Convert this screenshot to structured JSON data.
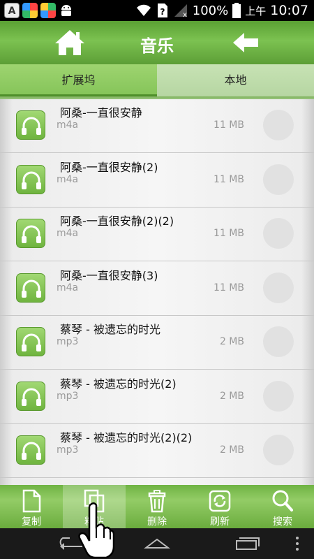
{
  "status_bar": {
    "icons": [
      "a-icon",
      "pinwheel-icon",
      "pinwheel-icon",
      "android-icon"
    ],
    "battery": "100%",
    "ampm": "上午",
    "time": "10:07"
  },
  "header": {
    "title": "音乐"
  },
  "tabs": [
    {
      "label": "扩展坞",
      "selected": true
    },
    {
      "label": "本地",
      "selected": false
    }
  ],
  "files": [
    {
      "name": "阿桑-一直很安静",
      "type": "m4a",
      "size": "11 MB"
    },
    {
      "name": "阿桑-一直很安静(2)",
      "type": "m4a",
      "size": "11 MB"
    },
    {
      "name": "阿桑-一直很安静(2)(2)",
      "type": "m4a",
      "size": "11 MB"
    },
    {
      "name": "阿桑-一直很安静(3)",
      "type": "m4a",
      "size": "11 MB"
    },
    {
      "name": "蔡琴 - 被遗忘的时光",
      "type": "mp3",
      "size": "2 MB"
    },
    {
      "name": "蔡琴 - 被遗忘的时光(2)",
      "type": "mp3",
      "size": "2 MB"
    },
    {
      "name": "蔡琴 - 被遗忘的时光(2)(2)",
      "type": "mp3",
      "size": "2 MB"
    }
  ],
  "toolbar": {
    "copy": "复制",
    "paste": "粘贴",
    "delete": "删除",
    "refresh": "刷新",
    "search": "搜索"
  },
  "colors": {
    "accent_green": "#7cc251",
    "dark_green": "#5a9a2f",
    "tab_active": "#9ed470",
    "tab_inactive": "#c7e2b4"
  }
}
